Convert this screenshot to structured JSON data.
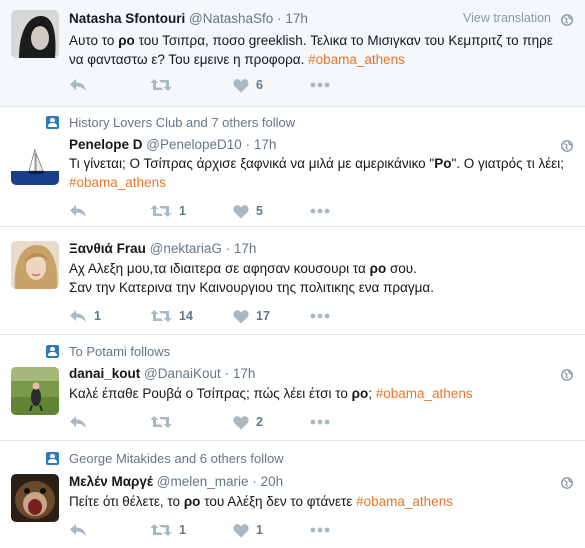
{
  "ui": {
    "view_translation": "View translation"
  },
  "tweets": [
    {
      "context": "",
      "fullname": "Natasha Sfontouri",
      "handle": "@NatashaSfo",
      "dot": "·",
      "time": "17h",
      "text": [
        {
          "t": "Αυτο το "
        },
        {
          "b": "ρο"
        },
        {
          "t": " του Τσιπρα, ποσο greeklish. Τελικα το Μισιγκαν του Κεμπριτζ το πηρε να φανταστω ε?  Του εμεινε η προφορα. "
        },
        {
          "h": "#obama_athens"
        }
      ],
      "replies": "",
      "retweets": "",
      "likes": "6"
    },
    {
      "context": "History Lovers Club and 7 others follow",
      "fullname": "Penelope D",
      "handle": "@PenelopeD10",
      "dot": "·",
      "time": "17h",
      "text": [
        {
          "t": "Τι γίνεται; Ο Τσίπρας άρχισε ξαφνικά να μιλά με αμερικάνικο \""
        },
        {
          "b": "Ρο"
        },
        {
          "t": "\". Ο γιατρός τι λέει; "
        },
        {
          "h": "#obama_athens"
        }
      ],
      "replies": "",
      "retweets": "1",
      "likes": "5"
    },
    {
      "context": "",
      "fullname": "Ξανθιά Frau",
      "handle": "@nektariaG",
      "dot": "·",
      "time": "17h",
      "text": [
        {
          "t": "Αχ Αλεξη μου,τα ιδιαιτερα σε αφησαν κουσουρι τα "
        },
        {
          "b": "ρο"
        },
        {
          "t": " σου."
        },
        {
          "br": true
        },
        {
          "t": "Σαν την Κατερινα την Καινουργιου της πολιτικης ενα πραγμα."
        }
      ],
      "replies": "1",
      "retweets": "14",
      "likes": "17"
    },
    {
      "context": "To Potami follows",
      "fullname": "danai_kout",
      "handle": "@DanaiKout",
      "dot": "·",
      "time": "17h",
      "text": [
        {
          "t": "Καλέ έπαθε Ρουβά ο Τσίπρας; πώς λέει έτσι το "
        },
        {
          "b": "ρο"
        },
        {
          "t": "; "
        },
        {
          "h": "#obama_athens"
        }
      ],
      "replies": "",
      "retweets": "",
      "likes": "2"
    },
    {
      "context": "George Mitakides and 6 others follow",
      "fullname": "Μελέν Μαργέ",
      "handle": "@melen_marie",
      "dot": "·",
      "time": "20h",
      "text": [
        {
          "t": "Πείτε ότι θέλετε, το "
        },
        {
          "b": "ρο"
        },
        {
          "t": " του Αλέξη δεν το φτάνετε "
        },
        {
          "h": "#obama_athens"
        }
      ],
      "replies": "",
      "retweets": "1",
      "likes": "1"
    }
  ],
  "colors": {
    "hashtag": "#e8762a",
    "muted": "#657786",
    "icon": "#aab8c2",
    "context_icon": "#2b7bb9",
    "divider": "#e1e8ed",
    "highlight_bg": "#f5f8fa"
  }
}
